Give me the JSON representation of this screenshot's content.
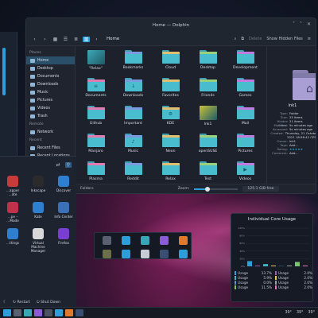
{
  "dolphin": {
    "title": "Home — Dolphin",
    "window_controls": [
      "˅",
      "˄",
      "✕"
    ],
    "breadcrumb": "Home",
    "toolbar": {
      "delete_label": "Delete",
      "show_hidden_label": "Show Hidden Files"
    },
    "places": {
      "sections": [
        {
          "title": "Places",
          "items": [
            "Home",
            "Desktop",
            "Documents",
            "Downloads",
            "Music",
            "Pictures",
            "Videos",
            "Trash"
          ]
        },
        {
          "title": "Remote",
          "items": [
            "Network"
          ]
        },
        {
          "title": "Recent",
          "items": [
            "Recent Files",
            "Recent Locations"
          ]
        }
      ],
      "selected": "Home"
    },
    "files": [
      {
        "name": "\"Relax\"",
        "kind": "image",
        "color": "#3fa9b8"
      },
      {
        "name": "Bookmarks",
        "kind": "folder",
        "glyph": ""
      },
      {
        "name": "Cloud",
        "kind": "folder",
        "glyph": ""
      },
      {
        "name": "Desktop",
        "kind": "folder",
        "glyph": ""
      },
      {
        "name": "Development",
        "kind": "folder",
        "glyph": ""
      },
      {
        "name": "Documents",
        "kind": "folder",
        "glyph": "≡"
      },
      {
        "name": "Downloads",
        "kind": "folder",
        "glyph": "↓"
      },
      {
        "name": "Favorites",
        "kind": "folder",
        "glyph": ""
      },
      {
        "name": "Friends",
        "kind": "folder",
        "glyph": ""
      },
      {
        "name": "Games",
        "kind": "folder",
        "glyph": ""
      },
      {
        "name": "Github",
        "kind": "folder",
        "glyph": ""
      },
      {
        "name": "Important",
        "kind": "folder",
        "glyph": ""
      },
      {
        "name": "KDE",
        "kind": "folder",
        "glyph": "⚙"
      },
      {
        "name": "lnk1",
        "kind": "image",
        "color": "#c9c23a"
      },
      {
        "name": "Mail",
        "kind": "folder",
        "glyph": ""
      },
      {
        "name": "Manjaro",
        "kind": "folder",
        "glyph": ""
      },
      {
        "name": "Music",
        "kind": "folder",
        "glyph": "♪"
      },
      {
        "name": "Neon",
        "kind": "folder",
        "glyph": ""
      },
      {
        "name": "openSUSE",
        "kind": "folder",
        "glyph": ""
      },
      {
        "name": "Pictures",
        "kind": "folder",
        "glyph": ""
      },
      {
        "name": "Plasma",
        "kind": "folder",
        "glyph": ""
      },
      {
        "name": "Reddit",
        "kind": "folder",
        "glyph": ""
      },
      {
        "name": "Relax",
        "kind": "folder",
        "glyph": ""
      },
      {
        "name": "Test",
        "kind": "folder",
        "glyph": ""
      },
      {
        "name": "Videos",
        "kind": "folder",
        "glyph": "▶"
      }
    ],
    "statusbar": {
      "folders": "Folders",
      "zoom_label": "Zoom:",
      "zoom_fraction": 0.3,
      "free_space": "125.1 GiB free"
    },
    "info_panel": {
      "name": "lnk1",
      "rows": [
        {
          "k": "Type:",
          "v": "Folder"
        },
        {
          "k": "Size:",
          "v": "25 items"
        },
        {
          "k": "Hidden items:",
          "v": "21 items"
        },
        {
          "k": "Modified:",
          "v": "5s minutes ago"
        },
        {
          "k": "Accessed:",
          "v": "5s minutes ago"
        },
        {
          "k": "Created:",
          "v": "Thursday, 21 October"
        },
        {
          "k": "",
          "v": "2021 18:56:42 CEST"
        },
        {
          "k": "Owner:",
          "v": "lnk1"
        },
        {
          "k": "Tags:",
          "v": "Add..."
        },
        {
          "k": "Rating:",
          "v": "★★★★★"
        },
        {
          "k": "Comment:",
          "v": "Add..."
        }
      ]
    }
  },
  "launcher": {
    "apps": [
      {
        "name": "…apper\n…ate",
        "icon": "doc-icon",
        "color": "#c83b3b"
      },
      {
        "name": "Inkscape",
        "icon": "inkscape-icon",
        "color": "#2b2b2b"
      },
      {
        "name": "Discover",
        "icon": "discover-icon",
        "color": "#2f7fd0"
      },
      {
        "name": "…pe –\n…Mode",
        "icon": "app-icon",
        "color": "#c0324a"
      },
      {
        "name": "Kate",
        "icon": "kate-icon",
        "color": "#2f7fd0"
      },
      {
        "name": "Info Center",
        "icon": "info-icon",
        "color": "#3b6fb6"
      },
      {
        "name": "…ttings",
        "icon": "settings-icon",
        "color": "#2f7fd0"
      },
      {
        "name": "Virtual Machine\nManager",
        "icon": "vm-icon",
        "color": "#d8d8d8"
      },
      {
        "name": "Firefox",
        "icon": "firefox-icon",
        "color": "#7a3fd0"
      }
    ],
    "footer": {
      "restart": "Restart",
      "shutdown": "Shut Down"
    }
  },
  "core_usage": {
    "title": "Individual Core Usage",
    "chart_data": {
      "type": "bar",
      "title": "Individual Core Usage",
      "ylim": [
        0,
        100
      ],
      "yticks": [
        "100%",
        "80%",
        "60%",
        "40%",
        "20%",
        "0%"
      ],
      "series": [
        {
          "color": "#2e9ed9",
          "value": 13.7
        },
        {
          "color": "#9b59b6",
          "value": 2.0
        },
        {
          "color": "#3fb6c4",
          "value": 5.9
        },
        {
          "color": "#e3c85a",
          "value": 2.0
        },
        {
          "color": "#5c8fd6",
          "value": 0.0
        },
        {
          "color": "#a0a0a0",
          "value": 2.0
        },
        {
          "color": "#7ac46a",
          "value": 11.5
        },
        {
          "color": "#e07abf",
          "value": 2.0
        }
      ]
    },
    "legend": [
      {
        "label": "Usage",
        "value": "13.7%",
        "color": "#2e9ed9"
      },
      {
        "label": "Usage",
        "value": "2.0%",
        "color": "#9b59b6"
      },
      {
        "label": "Usage",
        "value": "5.9%",
        "color": "#3fb6c4"
      },
      {
        "label": "Usage",
        "value": "2.0%",
        "color": "#e3c85a"
      },
      {
        "label": "Usage",
        "value": "0.0%",
        "color": "#5c8fd6"
      },
      {
        "label": "Usage",
        "value": "2.0%",
        "color": "#a0a0a0"
      },
      {
        "label": "Usage",
        "value": "11.5%",
        "color": "#7ac46a"
      },
      {
        "label": "Usage",
        "value": "2.0%",
        "color": "#e07abf"
      }
    ]
  },
  "taskbar": {
    "tray": [
      "39°",
      "39°",
      "39°"
    ]
  }
}
